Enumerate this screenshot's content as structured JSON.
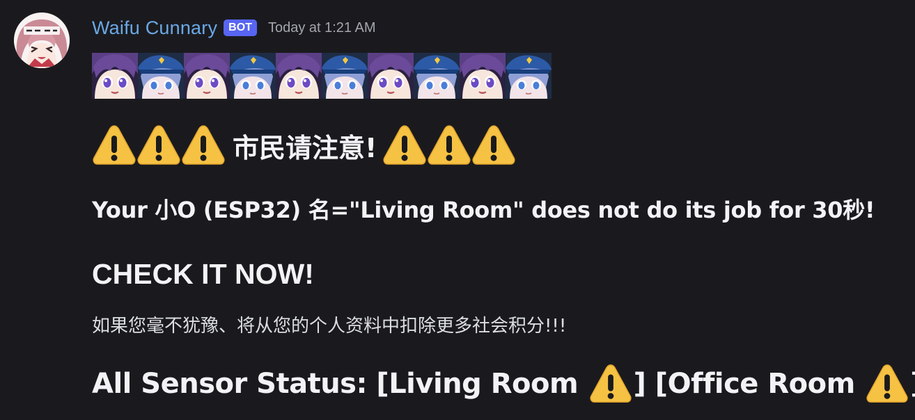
{
  "author": {
    "name": "Waifu Cunnary",
    "badge": "BOT",
    "timestamp": "Today at 1:21 AM",
    "avatar_icon": "anime-girl-avatar-icon",
    "name_color": "#6aa8e6"
  },
  "emotes": [
    {
      "icon": "purple-hair-girl-emote-icon"
    },
    {
      "icon": "police-cap-girl-emote-icon"
    },
    {
      "icon": "purple-hair-girl-emote-icon"
    },
    {
      "icon": "police-cap-girl-emote-icon"
    },
    {
      "icon": "purple-hair-girl-emote-icon"
    },
    {
      "icon": "police-cap-girl-emote-icon"
    },
    {
      "icon": "purple-hair-girl-emote-icon"
    },
    {
      "icon": "police-cap-girl-emote-icon"
    },
    {
      "icon": "purple-hair-girl-emote-icon"
    },
    {
      "icon": "police-cap-girl-emote-icon"
    }
  ],
  "content": {
    "heading": "市民请注意!",
    "line2": "Your 小O (ESP32) 名=\"Living Room\" does not do its job for 30秒!",
    "line3": "CHECK IT NOW!",
    "line4": "如果您毫不犹豫、将从您的个人资料中扣除更多社会积分!!!",
    "status_prefix": "All Sensor Status: [Living Room ",
    "status_middle": "] [Office Room ",
    "status_suffix": "]",
    "warning_icon": "warning-icon"
  }
}
